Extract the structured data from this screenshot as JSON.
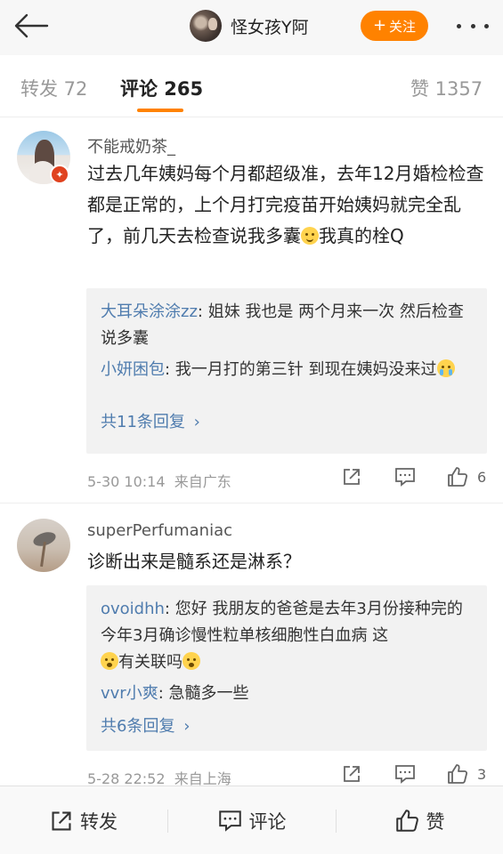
{
  "header": {
    "username": "怪女孩Y阿",
    "follow_label": "关注",
    "follow_icon": "plus-icon",
    "accent_color": "#ff8200"
  },
  "tabs": [
    {
      "label": "转发 72",
      "active": false
    },
    {
      "label": "评论 265",
      "active": true
    },
    {
      "label": "赞 1357",
      "active": false
    }
  ],
  "comments": [
    {
      "name": "不能戒奶茶_",
      "text_parts": [
        "过去几年姨妈每个月都超级准，去年12月婚检检查都是正常的，上个月打完疫苗开始姨妈就完全乱了，前几天去检查说我多囊",
        "我真的栓Q"
      ],
      "replies": [
        {
          "name": "大耳朵涂涂zz",
          "text": ": 姐妹 我也是 两个月来一次 然后检查说多囊"
        },
        {
          "name": "小妍困包",
          "text": ": 我一月打的第三针 到现在姨妈没来过"
        }
      ],
      "more_replies": "共11条回复",
      "time": "5-30 10:14",
      "source": "来自广东",
      "like_count": "6"
    },
    {
      "name": "superPerfumaniac",
      "text": "诊断出来是髓系还是淋系？",
      "replies": [
        {
          "name": "ovoidhh",
          "text": ": 您好 我朋友的爸爸是去年3月份接种完的 今年3月确诊慢性粒单核细胞性白血病 这",
          "text_tail": "有关联吗"
        },
        {
          "name": "vvr小爽",
          "text": ": 急髓多一些"
        }
      ],
      "more_replies": "共6条回复",
      "time": "5-28 22:52",
      "source": "来自上海",
      "like_count": "3"
    }
  ],
  "bottom_bar": [
    {
      "label": "转发",
      "icon": "share-icon"
    },
    {
      "label": "评论",
      "icon": "comment-icon"
    },
    {
      "label": "赞",
      "icon": "like-icon"
    }
  ]
}
